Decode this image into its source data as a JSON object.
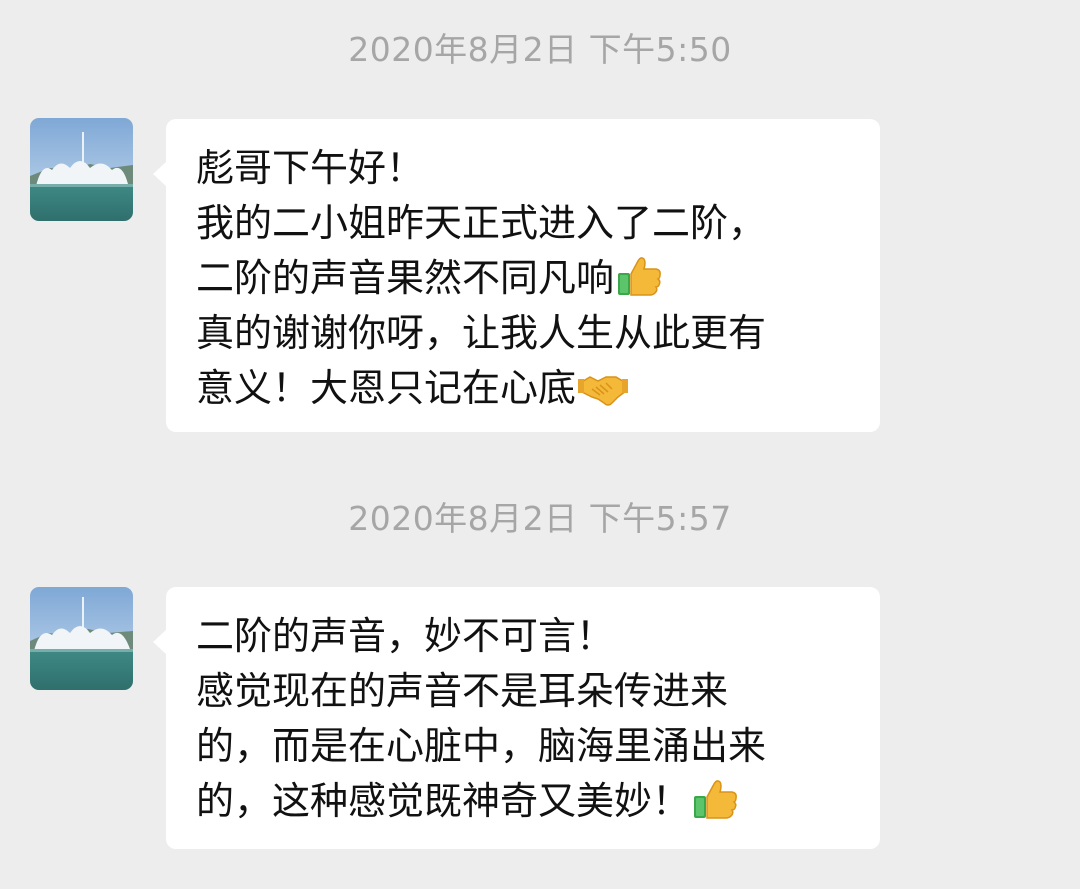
{
  "messages": [
    {
      "timestamp": "2020年8月2日 下午5:50",
      "lines": [
        "彪哥下午好！",
        "我的二小姐昨天正式进入了二阶，",
        "二阶的声音果然不同凡响",
        "真的谢谢你呀，让我人生从此更有",
        "意义！大恩只记在心底"
      ],
      "emojis": [
        "thumbs-up-icon",
        "handshake-icon"
      ]
    },
    {
      "timestamp": "2020年8月2日 下午5:57",
      "lines": [
        "二阶的声音，妙不可言！",
        "感觉现在的声音不是耳朵传进来",
        "的，而是在心脏中，脑海里涌出来",
        "的，这种感觉既神奇又美妙！"
      ],
      "emojis": [
        "thumbs-up-icon"
      ]
    }
  ],
  "colors": {
    "background": "#ededed",
    "bubble": "#ffffff",
    "timestamp_text": "#a6a6a6",
    "message_text": "#111111"
  }
}
